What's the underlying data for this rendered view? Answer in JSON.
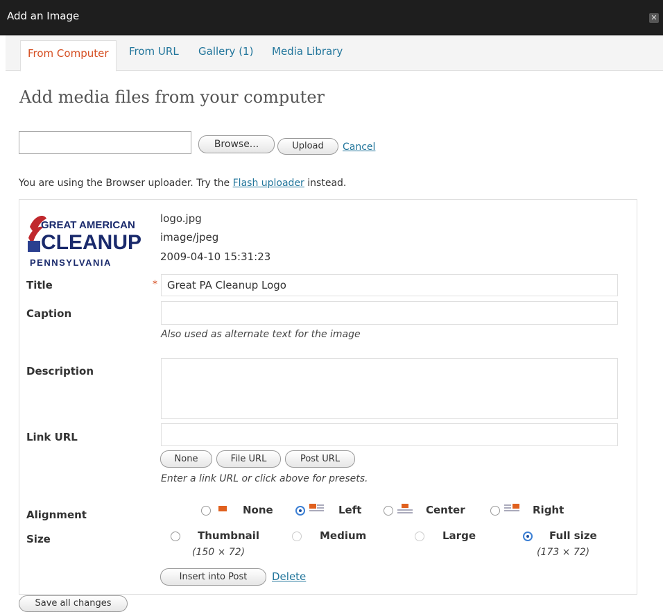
{
  "window": {
    "title": "Add an Image",
    "close_glyph": "✕"
  },
  "tabs": [
    {
      "label": "From Computer"
    },
    {
      "label": "From URL"
    },
    {
      "label": "Gallery (1)"
    },
    {
      "label": "Media Library"
    }
  ],
  "heading": "Add media files from your computer",
  "upload": {
    "browse_label": "Browse...",
    "upload_label": "Upload",
    "cancel_label": "Cancel",
    "note_prefix": "You are using the Browser uploader. Try the",
    "note_link": "Flash uploader",
    "note_suffix": "instead."
  },
  "file": {
    "logo_line1": "GREAT AMERICAN",
    "logo_line2": "CLEANUP",
    "logo_line3": "PENNSYLVANIA",
    "filename": "logo.jpg",
    "mime": "image/jpeg",
    "date": "2009-04-10 15:31:23"
  },
  "form": {
    "title_label": "Title",
    "required_mark": "*",
    "title_value": "Great PA Cleanup Logo",
    "caption_label": "Caption",
    "caption_help": "Also used as alternate text for the image",
    "description_label": "Description",
    "link_label": "Link URL",
    "link_buttons": [
      "None",
      "File URL",
      "Post URL"
    ],
    "link_help": "Enter a link URL or click above for presets.",
    "alignment_label": "Alignment",
    "alignment_options": [
      "None",
      "Left",
      "Center",
      "Right"
    ],
    "alignment_selected": "Left",
    "size_label": "Size",
    "size_options": [
      "Thumbnail",
      "Medium",
      "Large",
      "Full size"
    ],
    "size_thumbnail_dims": "(150 × 72)",
    "size_full_dims": "(173 × 72)",
    "size_selected": "Full size",
    "insert_label": "Insert into Post",
    "delete_label": "Delete"
  },
  "footer": {
    "save_label": "Save all changes"
  },
  "colors": {
    "accent_link": "#21759b",
    "active_tab": "#d54e21",
    "titlebar": "#1e1e1e"
  }
}
